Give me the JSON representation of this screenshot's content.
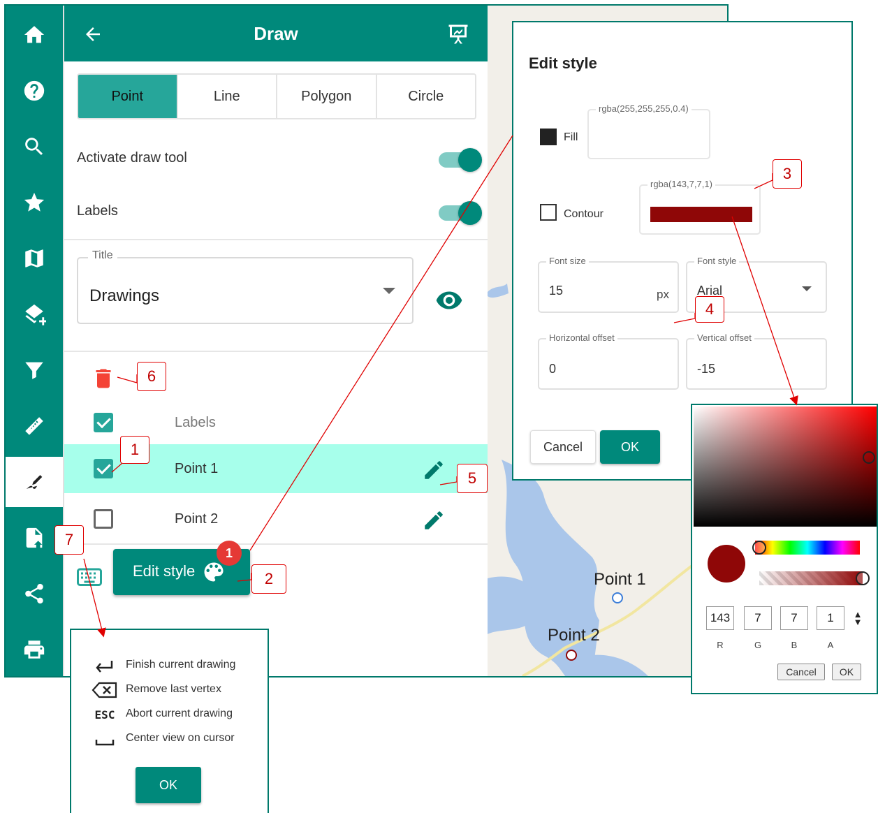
{
  "panel": {
    "title": "Draw",
    "tabs": [
      "Point",
      "Line",
      "Polygon",
      "Circle"
    ],
    "active_tab": "Point",
    "activate_draw_tool_label": "Activate draw tool",
    "labels_toggle_label": "Labels",
    "title_field": {
      "label": "Title",
      "value": "Drawings"
    },
    "list": {
      "header_label": "Labels",
      "rows": [
        {
          "label": "Point 1",
          "checked": true,
          "selected": true
        },
        {
          "label": "Point 2",
          "checked": false,
          "selected": false
        }
      ]
    },
    "edit_style_label": "Edit style",
    "edit_style_badge": "1"
  },
  "rail": {
    "icons": [
      "home-icon",
      "help-icon",
      "search-icon",
      "star-icon",
      "map-icon",
      "add-layer-icon",
      "filter-icon",
      "ruler-icon",
      "draw-icon",
      "export-file-icon",
      "share-icon",
      "print-icon"
    ],
    "active": "draw-icon"
  },
  "map": {
    "labels": [
      "Point 1",
      "Point 2"
    ]
  },
  "edit_style_dialog": {
    "title": "Edit style",
    "fill_label": "Fill",
    "fill_value": "rgba(255,255,255,0.4)",
    "contour_label": "Contour",
    "contour_value": "rgba(143,7,7,1)",
    "font_size_label": "Font size",
    "font_size_value": "15",
    "font_size_unit": "px",
    "font_style_label": "Font style",
    "font_style_value": "Arial",
    "horizontal_offset_label": "Horizontal offset",
    "horizontal_offset_value": "0",
    "vertical_offset_label": "Vertical offset",
    "vertical_offset_value": "-15",
    "cancel_label": "Cancel",
    "ok_label": "OK"
  },
  "color_picker": {
    "r": "143",
    "g": "7",
    "b": "7",
    "a": "1",
    "r_label": "R",
    "g_label": "G",
    "b_label": "B",
    "a_label": "A",
    "cancel_label": "Cancel",
    "ok_label": "OK"
  },
  "shortcuts": {
    "items": [
      {
        "key": "",
        "icon": "enter-icon",
        "text": "Finish current drawing"
      },
      {
        "key": "",
        "icon": "backspace-icon",
        "text": "Remove last vertex"
      },
      {
        "key": "ESC",
        "icon": "",
        "text": "Abort current drawing"
      },
      {
        "key": "",
        "icon": "space-icon",
        "text": "Center view on cursor"
      }
    ],
    "ok_label": "OK"
  },
  "callouts": [
    "1",
    "2",
    "3",
    "4",
    "5",
    "6",
    "7"
  ],
  "colors": {
    "teal": "#00897b",
    "teal_light": "#26a69a",
    "selected_row": "#a7ffeb",
    "contour": "#8f0707",
    "callout_red": "#e00000",
    "delete_red": "#f44336"
  }
}
